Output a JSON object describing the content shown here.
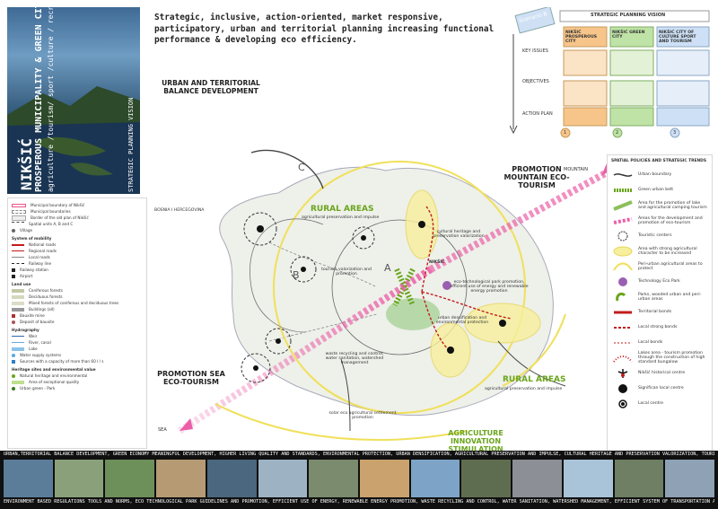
{
  "cover": {
    "title": "NIKŠIĆ",
    "line2": "PROSPEROUS MUNICIPALITY & GREEN CITY",
    "line3": "agriculture /tourism/ sport /culture / recreation",
    "line4": "STRATEGIC PLANNING VISION"
  },
  "subtitle": "Strategic, inclusive, action-oriented, market responsive, participatory, urban and territorial planning increasing functional performance & developing eco efficiency.",
  "vision": {
    "scenario": "Scenario B",
    "header": "STRATEGIC PLANNING VISION",
    "col1": "NIKŠIĆ PROSPEROUS CITY",
    "col2": "NIKŠIĆ GREEN CITY",
    "col3": "NIKŠIĆ CITY OF CULTURE SPORT AND TOURISM",
    "row1": "KEY ISSUES",
    "row2": "OBJECTIVES",
    "row3": "ACTION PLAN",
    "action": "ACTION PLAN",
    "n1": "1",
    "n2": "2",
    "n3": "3"
  },
  "map": {
    "balance_title": "URBAN AND TERRITORIAL BALANCE DEVELOPMENT",
    "mountain_title": "PROMOTION MOUNTAIN ECO-TOURISM",
    "mountain_tag": "MOUNTAIN",
    "sea_title": "PROMOTION SEA ECO-TOURISM",
    "sea_tag": "SEA",
    "rural1": "RURAL AREAS",
    "rural1_sub": "agricultural preservation and impulse",
    "rural2": "RURAL AREAS",
    "rural2_sub": "agricultural preservation and impulse",
    "agri_title": "AGRICULTURE INNOVATION STIMULATION",
    "bosnia": "BOSNIA I HERCEGOVINA",
    "zone_a": "A",
    "zone_b": "B",
    "zone_c": "C",
    "nikšić": "NIKŠIĆ",
    "heritage": "cultural heritage and preservation valorization",
    "tourism": "tourism valorization and promotion",
    "ecotech": "eco-technological park promotion, efficient use of energy and renewable energy promotion",
    "urban": "urban densification and environmental protection",
    "waste": "waste recycling and control, water sanitation, watershed management",
    "solar": "solar eco agricultural settlement promotion"
  },
  "legend": {
    "items": [
      "Municipal boundary of Nikšić",
      "Municipal boundaries",
      "Border of the old plan of Nikšić",
      "Spatial units A, B and C",
      "Village"
    ],
    "mobility": "System of mobility",
    "mobility_items": [
      "National roads",
      "Regional roads",
      "Local roads",
      "Railway line",
      "Railway station",
      "Airport"
    ],
    "landuse": "Land use",
    "landuse_items": [
      "Coniferous forests",
      "Deciduous forests",
      "Mixed forests of coniferous and deciduous trees",
      "Buildings (all)",
      "Bauxite mine",
      "Deposit of bauxite"
    ],
    "hydro": "Hydrography",
    "hydro_items": [
      "Weir",
      "River, canal",
      "Lake",
      "Water supply systems",
      "Sources with a capacity of more than 60 l / s"
    ],
    "heritage": "Heritage sites and environmental value",
    "heritage_items": [
      "Natural heritage and environmental",
      "Area of exceptional quality",
      "Urban green - Park"
    ]
  },
  "right_legend": {
    "title": "SPATIAL POLICIES AND STRATEGIC TRENDS",
    "items": [
      "Urban boundary",
      "Green urban belt",
      "Area for the promotion of lake and agricultural camping tourism",
      "Areas for the development and promotion of eco-tourism",
      "Touristic centers",
      "Area with strong agricultural character to be increased",
      "Peri-urban agricultural areas to protect",
      "Technology Eco Park",
      "Parks, wooded urban and peri-urban areas",
      "Territorial bonds",
      "Local strong bonds",
      "Local bonds",
      "Lakes area - tourism promotion through the construction of high standard bungalow",
      "Nikšić historical centre",
      "Significan local centre",
      "Local centre"
    ]
  },
  "band": {
    "top": "URBAN,TERRITORIAL BALANCE DEVELOPMENT, GREEN ECONOMY MEANINGFUL DEVELOPMENT, HIGHER LIVING QUALITY AND STANDARDS, ENVIRONMENTAL PROTECTION, URBAN DENSIFICATION, AGRICULTURAL PRESERVATION AND IMPULSE, CULTURAL HERITAGE AND PRESERVATION VALORIZATION, TOURISM VALORIZATION",
    "bottom": "ENVIRONMENT BASED REGULATIONS TOOLS AND NORMS, ECO TECHNOLOGICAL PARK GUIDELINES AND PROMOTION, EFFICIENT USE OF ENERGY, RENEWABLE ENERGY PROMOTION, WASTE RECYCLING AND CONTROL, WATER SANITATION, WATERSHED MANAGEMENT, EFFICIENT SYSTEM OF TRANSPORTATION AND TERRITORIAL MOBILITY"
  },
  "colors": {
    "pink": "#ec5fa8",
    "green": "#6aa51c",
    "yellow": "#f0e05a",
    "dark": "#1a1a1a"
  }
}
